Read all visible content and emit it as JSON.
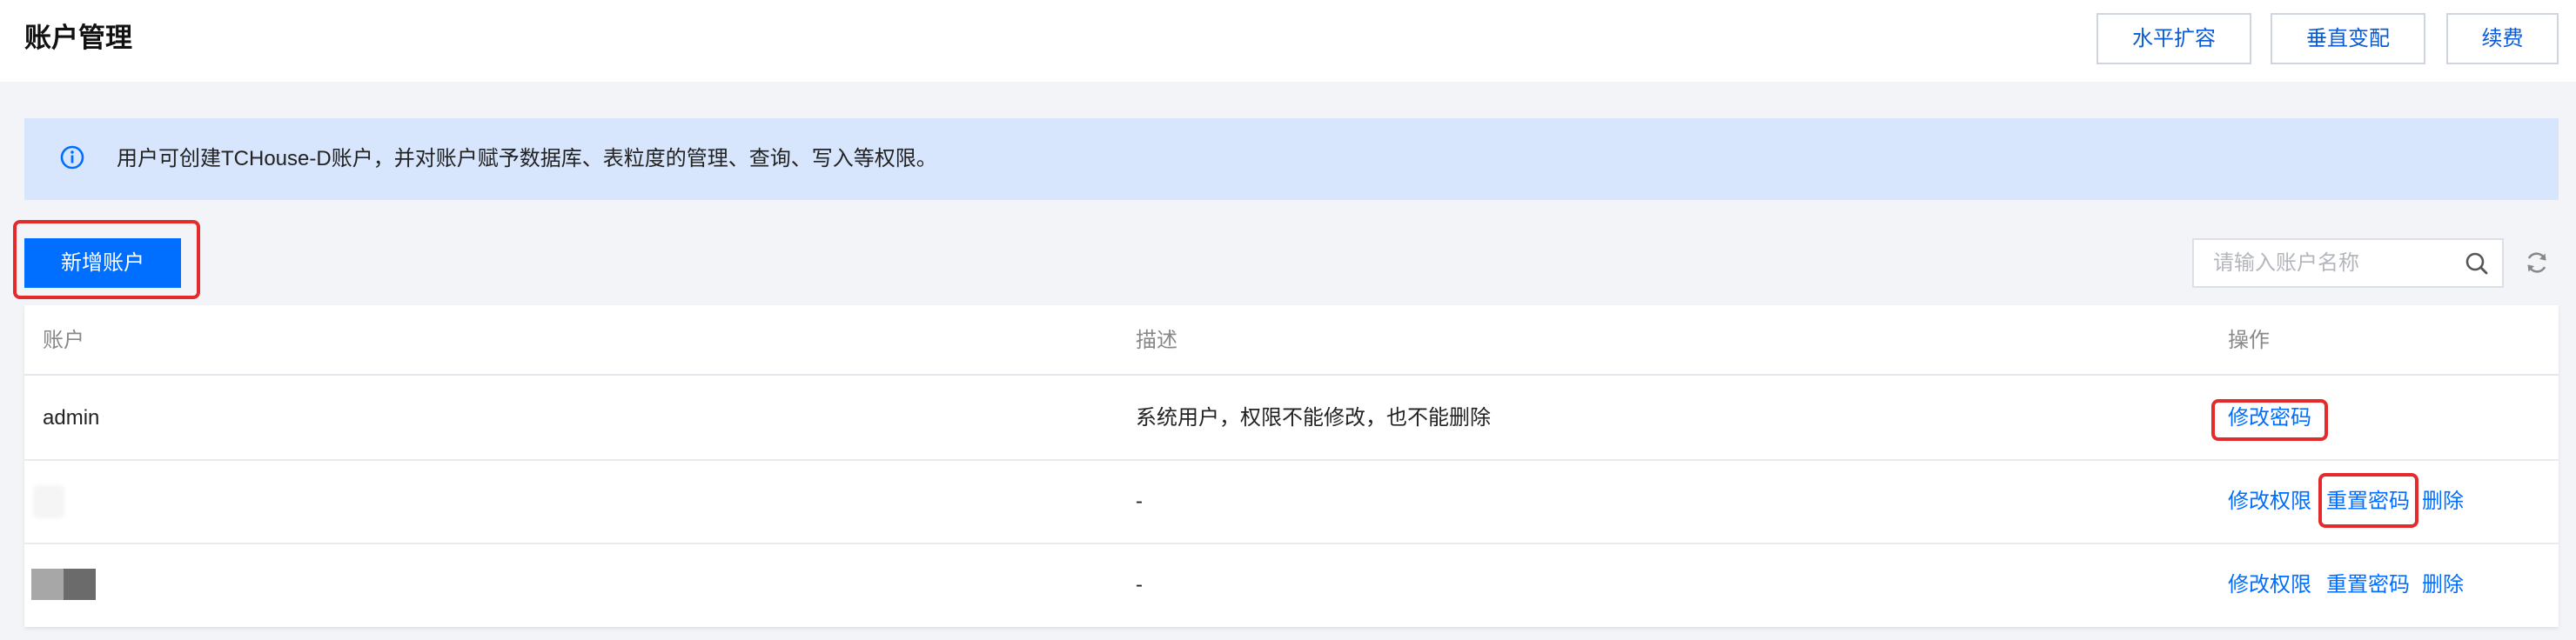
{
  "header": {
    "title": "账户管理",
    "buttons": {
      "scale_out": "水平扩容",
      "scale_up": "垂直变配",
      "renew": "续费"
    }
  },
  "notice": {
    "icon": "info-icon",
    "text": "用户可创建TCHouse-D账户，并对账户赋予数据库、表粒度的管理、查询、写入等权限。"
  },
  "toolbar": {
    "add_label": "新增账户",
    "search_placeholder": "请输入账户名称",
    "search_icon": "search-icon",
    "refresh_icon": "refresh-icon"
  },
  "table": {
    "columns": [
      "账户",
      "描述",
      "操作"
    ],
    "rows": [
      {
        "account": "admin",
        "description": "系统用户，权限不能修改，也不能删除",
        "actions": [
          "修改密码"
        ]
      },
      {
        "description": "-",
        "actions": [
          "修改权限",
          "重置密码",
          "删除"
        ]
      },
      {
        "description": "-",
        "actions": [
          "修改权限",
          "重置密码",
          "删除"
        ]
      }
    ]
  },
  "colors": {
    "primary": "#006eff",
    "notice_bg": "#d7e6fc",
    "highlight": "#e42a2a",
    "page_bg": "#f3f4f7"
  }
}
